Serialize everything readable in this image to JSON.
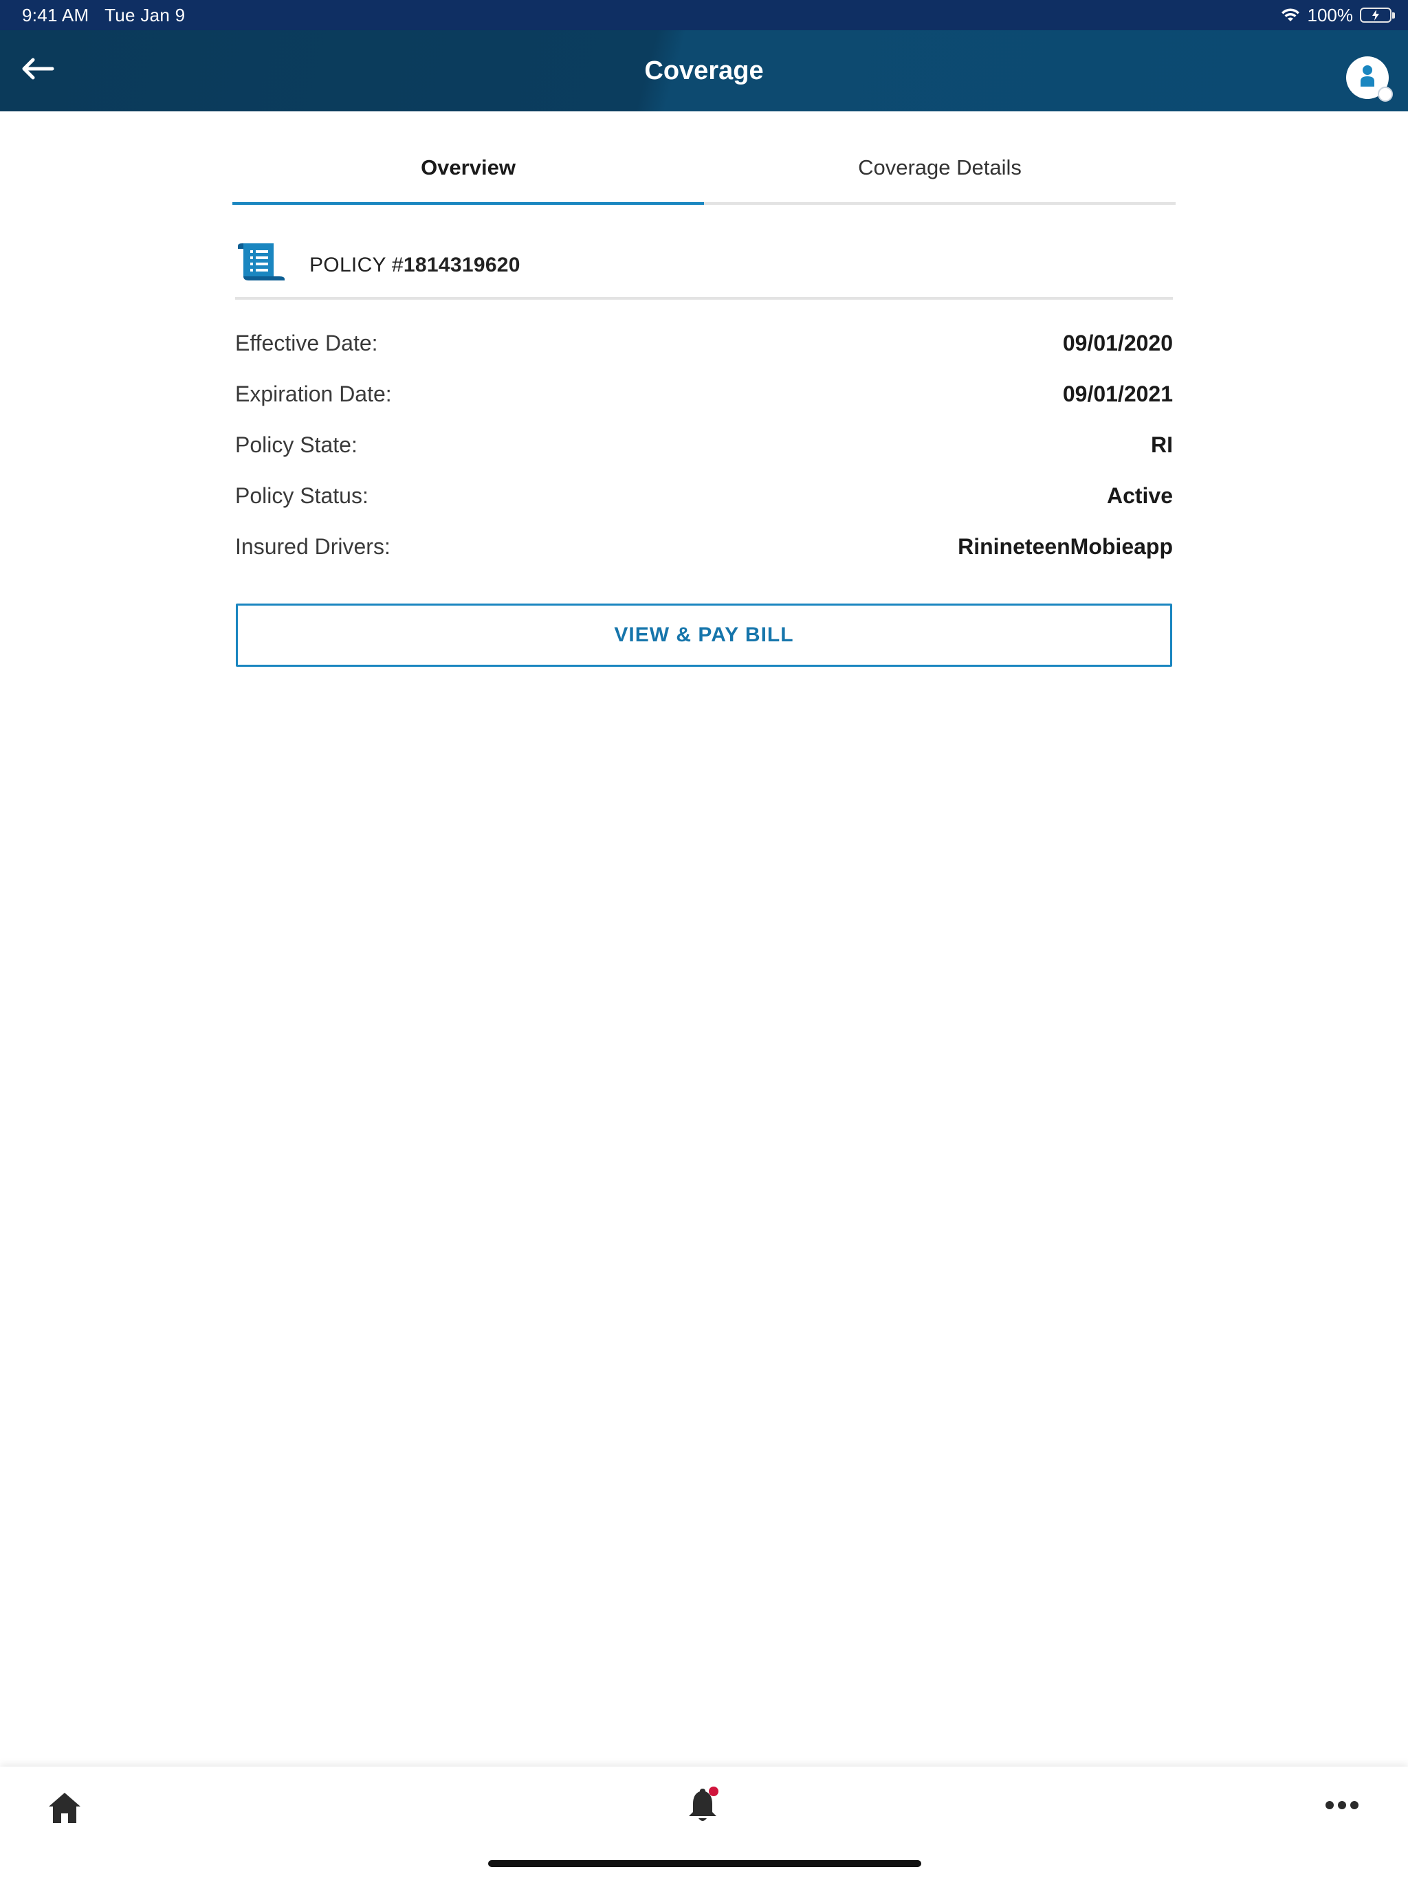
{
  "status_bar": {
    "time": "9:41 AM",
    "date": "Tue Jan 9",
    "battery_percent": "100%",
    "icons": [
      "wifi-icon",
      "battery-charging-icon"
    ]
  },
  "header": {
    "title": "Coverage",
    "back_icon": "arrow-left-icon",
    "profile_icon": "user-avatar-icon"
  },
  "tabs": [
    {
      "label": "Overview",
      "active": true
    },
    {
      "label": "Coverage Details",
      "active": false
    }
  ],
  "policy": {
    "prefix": "POLICY #",
    "number": "1814319620",
    "icon": "scroll-document-icon"
  },
  "details": [
    {
      "label": "Effective Date:",
      "value": "09/01/2020"
    },
    {
      "label": "Expiration Date:",
      "value": "09/01/2021"
    },
    {
      "label": "Policy State:",
      "value": "RI"
    },
    {
      "label": "Policy Status:",
      "value": "Active"
    },
    {
      "label": "Insured Drivers:",
      "value": "RinineteenMobieapp"
    }
  ],
  "actions": {
    "pay_bill_label": "VIEW & PAY BILL"
  },
  "bottom_nav": {
    "items": [
      {
        "icon": "home-icon"
      },
      {
        "icon": "bell-icon",
        "has_notification_dot": true
      },
      {
        "icon": "more-horizontal-icon"
      }
    ]
  },
  "colors": {
    "status_bar": "#0f2f63",
    "header": "#0b3d5e",
    "accent": "#1a86c0",
    "notification_dot": "#d0143c",
    "battery": "#34c759"
  }
}
